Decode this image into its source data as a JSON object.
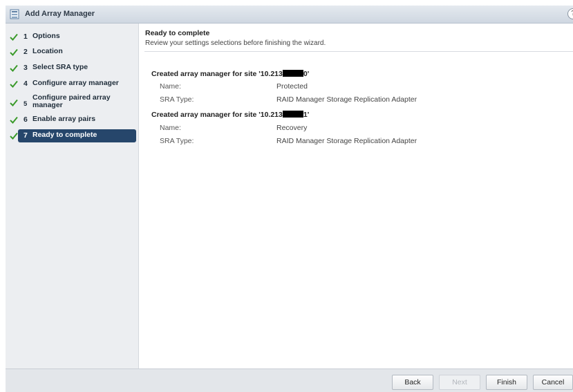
{
  "window": {
    "title": "Add Array Manager",
    "help_glyph": "?"
  },
  "sidebar": {
    "steps": [
      {
        "num": "1",
        "label": "Options",
        "state": "done"
      },
      {
        "num": "2",
        "label": "Location",
        "state": "done"
      },
      {
        "num": "3",
        "label": "Select SRA type",
        "state": "done"
      },
      {
        "num": "4",
        "label": "Configure array manager",
        "state": "done"
      },
      {
        "num": "5",
        "label": "Configure paired array manager",
        "state": "done"
      },
      {
        "num": "6",
        "label": "Enable array pairs",
        "state": "done"
      },
      {
        "num": "7",
        "label": "Ready to complete",
        "state": "active"
      }
    ]
  },
  "main": {
    "title": "Ready to complete",
    "subtitle": "Review your settings selections before finishing the wizard.",
    "sections": [
      {
        "heading_prefix": "Created array manager for site '10.213",
        "heading_suffix": "0'",
        "fields": [
          {
            "key": "Name:",
            "value": "Protected"
          },
          {
            "key": "SRA Type:",
            "value": "RAID Manager Storage Replication Adapter"
          }
        ]
      },
      {
        "heading_prefix": "Created array manager for site '10.213",
        "heading_suffix": "1'",
        "fields": [
          {
            "key": "Name:",
            "value": "Recovery"
          },
          {
            "key": "SRA Type:",
            "value": "RAID Manager Storage Replication Adapter"
          }
        ]
      }
    ]
  },
  "footer": {
    "back": "Back",
    "next": "Next",
    "finish": "Finish",
    "cancel": "Cancel"
  },
  "colors": {
    "active_step_bg": "#26466b",
    "check_green": "#3a9a2a"
  }
}
